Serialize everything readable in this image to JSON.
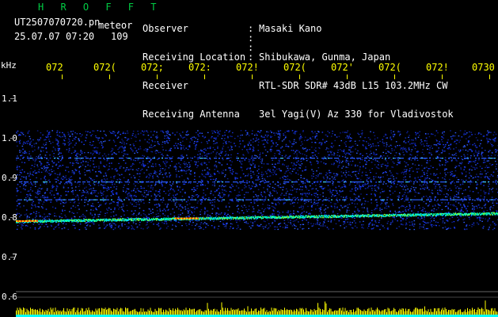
{
  "header": {
    "brand": "H R O F F T",
    "filename": "UT2507070720.pn",
    "event_type": "meteor",
    "datetime": "25.07.07 07:20",
    "count": "109"
  },
  "meta": [
    {
      "label": "Observer",
      "value": "Masaki Kano"
    },
    {
      "label": "Receiving Location",
      "value": "Shibukawa, Gunma, Japan"
    },
    {
      "label": "Receiver",
      "value": "RTL-SDR SDR# 43dB L15 103.2MHz CW"
    },
    {
      "label": "Receiving Antenna",
      "value": "3el Yagi(V) Az 330 for Vladivostok"
    }
  ],
  "time_axis": {
    "labels": [
      "072",
      "072(",
      "072;",
      "072:",
      "072!",
      "072(",
      "072'",
      "072(",
      "072!",
      "0730"
    ]
  },
  "freq_axis": {
    "unit": "kHz",
    "labels": [
      "1.1",
      "1.0",
      "0.9",
      "0.8",
      "0.7",
      "0.6"
    ]
  },
  "colors": {
    "background": "#000000",
    "noise": "#1a3aff",
    "trace": "#00ffaa",
    "hot": "#ff4400",
    "tick_text": "#ffff00",
    "brand": "#00cc44",
    "bottom_strip": "#ffff00",
    "bottom_base": "#00ffff"
  },
  "chart_data": {
    "type": "heatmap",
    "xlabel": "",
    "ylabel": "kHz",
    "ylim": [
      0.6,
      1.1
    ],
    "band_range_khz": [
      0.77,
      1.02
    ],
    "carrier_trace_khz": {
      "start": 0.79,
      "end": 0.81
    },
    "hot_spots_khz": [
      0.8,
      0.79
    ],
    "grid": false
  }
}
